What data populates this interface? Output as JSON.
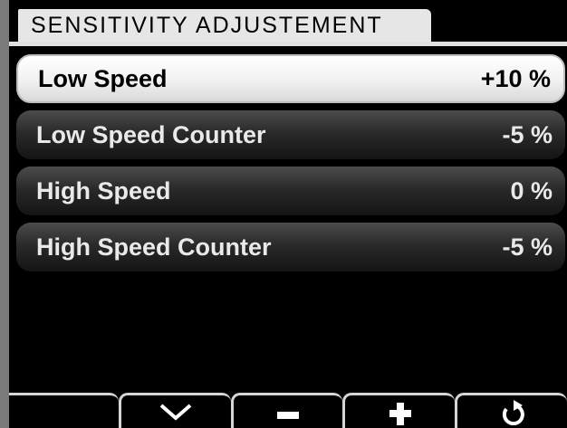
{
  "screen": {
    "title": "SENSITIVITY ADJUSTEMENT"
  },
  "settings": [
    {
      "label": "Low Speed",
      "value": "+10 %",
      "selected": true
    },
    {
      "label": "Low Speed Counter",
      "value": "-5 %",
      "selected": false
    },
    {
      "label": "High Speed",
      "value": "0 %",
      "selected": false
    },
    {
      "label": "High Speed Counter",
      "value": "-5 %",
      "selected": false
    }
  ],
  "softkeys": [
    {
      "icon": "blank"
    },
    {
      "icon": "chevron-down-icon"
    },
    {
      "icon": "minus-icon"
    },
    {
      "icon": "plus-icon"
    },
    {
      "icon": "undo-icon"
    }
  ],
  "colors": {
    "background": "#000000",
    "title_bar": "#e6e6e6",
    "row_dark": "#2a2a2a",
    "row_selected": "#f1f1f1",
    "bezel": "#7a7a7a"
  }
}
